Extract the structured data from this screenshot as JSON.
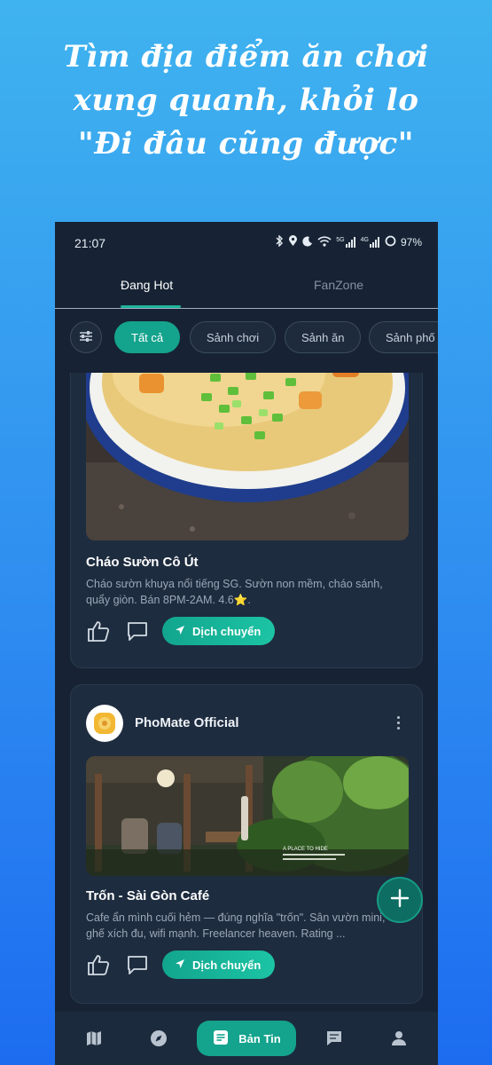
{
  "headline": {
    "line1": "Tìm địa điểm ăn chơi",
    "line2": "xung quanh, khỏi lo",
    "line3": "\"Đi đâu cũng được\""
  },
  "status_bar": {
    "time": "21:07",
    "battery": "97%",
    "signal1": "5G",
    "signal2": "4G"
  },
  "tabs": [
    {
      "label": "Đang Hot",
      "active": true
    },
    {
      "label": "FanZone",
      "active": false
    }
  ],
  "filter_chips": [
    {
      "label": "Tất cả",
      "active": true
    },
    {
      "label": "Sảnh chơi",
      "active": false
    },
    {
      "label": "Sảnh ăn",
      "active": false
    },
    {
      "label": "Sảnh phố",
      "active": false
    }
  ],
  "posts": [
    {
      "title": "Cháo Sườn Cô Út",
      "description": "Cháo sườn khuya nổi tiếng SG. Sườn non mềm, cháo sánh, quẩy giòn. Bán 8PM-2AM. 4.6⭐.",
      "action_label": "Dịch chuyển"
    },
    {
      "author": "PhoMate Official",
      "title": "Trốn - Sài Gòn Café",
      "image_caption": "A PLACE TO HIDE",
      "description": "Cafe ẩn mình cuối hẻm — đúng nghĩa \"trốn\". Sân vườn mini, ghế xích đu, wifi mạnh. Freelancer heaven. Rating ...",
      "action_label": "Dịch chuyển"
    }
  ],
  "bottom_nav": {
    "active_label": "Bản Tin"
  },
  "colors": {
    "accent": "#14a38d",
    "background": "#172334",
    "card": "#1e2c3f"
  }
}
